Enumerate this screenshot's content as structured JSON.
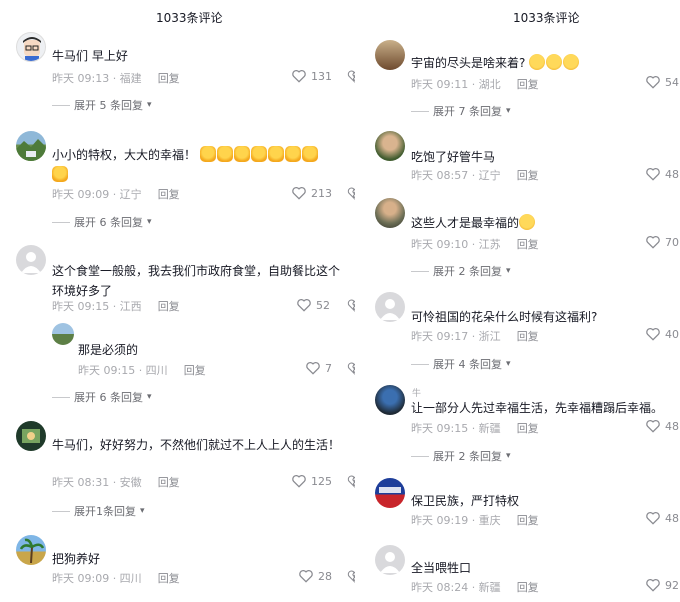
{
  "left": {
    "title": "1033条评论",
    "comments": [
      {
        "name": "",
        "text": "牛马们 早上好",
        "time": "昨天 09:13 · 福建",
        "reply": "回复",
        "likes": "131",
        "expand": "展开 5 条回复"
      },
      {
        "name": "",
        "text": "小小的特权，大大的幸福！",
        "time": "昨天 09:09 · 辽宁",
        "reply": "回复",
        "likes": "213",
        "expand": "展开 6 条回复"
      },
      {
        "name": "",
        "text": "这个食堂一般般，我去我们市政府食堂，自助餐比这个环境好多了",
        "time": "昨天 09:15 · 江西",
        "reply": "回复",
        "likes": "52"
      },
      {
        "name": "",
        "text": "那是必须的",
        "time": "昨天 09:15 · 四川",
        "reply": "回复",
        "likes": "7",
        "expand": "展开 6 条回复"
      },
      {
        "name": "",
        "text": "牛马们，好好努力，不然他们就过不上人上人的生活！",
        "time": "昨天 08:31 · 安徽",
        "reply": "回复",
        "likes": "125",
        "expand": "展开1条回复"
      },
      {
        "name": "",
        "text": "把狗养好",
        "time": "昨天 09:09 · 四川",
        "reply": "回复",
        "likes": "28"
      }
    ]
  },
  "right": {
    "title": "1033条评论",
    "comments": [
      {
        "name": "",
        "text": "宇宙的尽头是啥来着?",
        "time": "昨天 09:11 · 湖北",
        "reply": "回复",
        "likes": "54",
        "expand": "展开 7 条回复"
      },
      {
        "name": "",
        "text": "吃饱了好管牛马",
        "time": "昨天 08:57 · 辽宁",
        "reply": "回复",
        "likes": "48"
      },
      {
        "name": "",
        "text": "这些人才是最幸福的",
        "time": "昨天 09:10 · 江苏",
        "reply": "回复",
        "likes": "70",
        "expand": "展开 2 条回复"
      },
      {
        "name": "",
        "text": "可怜祖国的花朵什么时候有这福利?",
        "time": "昨天 09:17 · 浙江",
        "reply": "回复",
        "likes": "40",
        "expand": "展开 4 条回复"
      },
      {
        "name": "牛",
        "text": "让一部分人先过幸福生活，先幸福糟蹋后幸福。",
        "time": "昨天 09:15 · 新疆",
        "reply": "回复",
        "likes": "48",
        "expand": "展开 2 条回复"
      },
      {
        "name": "",
        "text": "保卫民族，严打特权",
        "time": "昨天 09:19 · 重庆",
        "reply": "回复",
        "likes": "48"
      },
      {
        "name": "",
        "text": "全当喂牲口",
        "time": "昨天 08:24 · 新疆",
        "reply": "回复",
        "likes": "92"
      }
    ]
  },
  "icons": {
    "like": "heart-outline-icon",
    "dislike": "broken-heart-icon",
    "expand": "chevron-down-icon"
  },
  "colors": {
    "meta": "#a8a9ae",
    "text": "#161823"
  }
}
